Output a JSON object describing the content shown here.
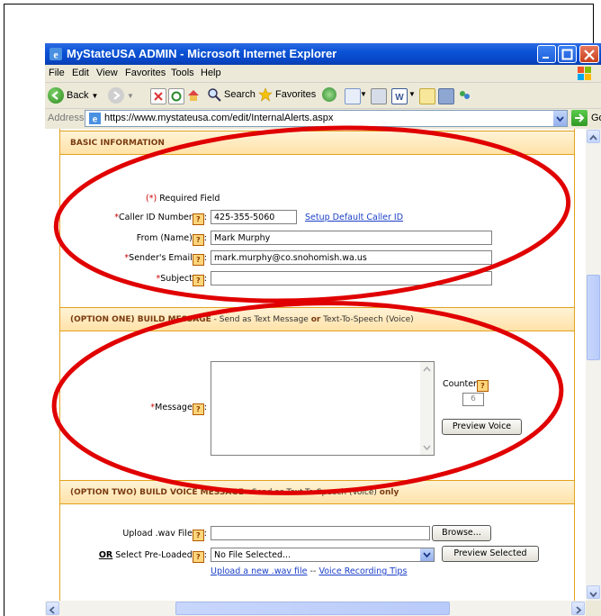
{
  "window": {
    "title": "MyStateUSA ADMIN - Microsoft Internet Explorer"
  },
  "menu": {
    "items": [
      "File",
      "Edit",
      "View",
      "Favorites",
      "Tools",
      "Help"
    ]
  },
  "toolbar": {
    "back": "Back",
    "search": "Search",
    "favorites": "Favorites"
  },
  "address": {
    "label": "Address",
    "url": "https://www.mystateusa.com/edit/InternalAlerts.aspx",
    "go": "Go"
  },
  "basic": {
    "header": "BASIC INFORMATION",
    "required_note": "(*) Required Field",
    "caller_id_label": "*Caller ID Number",
    "caller_id_value": "425-355-5060",
    "setup_link": "Setup Default Caller ID",
    "from_label": "From (Name)",
    "from_value": "Mark Murphy",
    "email_label": "*Sender's Email",
    "email_value": "mark.murphy@co.snohomish.wa.us",
    "subject_label": "*Subject",
    "subject_value": ""
  },
  "option_one": {
    "header_prefix": "(OPTION ONE)",
    "header_main": " BUILD MESSAGE",
    "header_rest": " - Send as Text Message ",
    "header_or": "or",
    "header_tail": " Text-To-Speech (Voice)",
    "message_label": "*Message",
    "counter_label": "Counter",
    "counter_value": "6",
    "preview_voice": "Preview Voice"
  },
  "option_two": {
    "header_prefix": "(OPTION TWO)",
    "header_main": " BUILD VOICE MESSAGE",
    "header_rest": " - Send as Text-To-Speech (Voice) ",
    "header_only": "only",
    "upload_label": "Upload .wav File",
    "browse": "Browse...",
    "or_label": "OR",
    "preloaded_label": " Select Pre-Loaded",
    "preloaded_value": "No File Selected...",
    "preview_selected": "Preview Selected",
    "upload_link": "Upload a new .wav file",
    "separator": " -- ",
    "tips_link": "Voice Recording Tips"
  },
  "colors": {
    "annotation": "#e00000",
    "header_text": "#7a3b10",
    "link": "#1a3fc7"
  }
}
